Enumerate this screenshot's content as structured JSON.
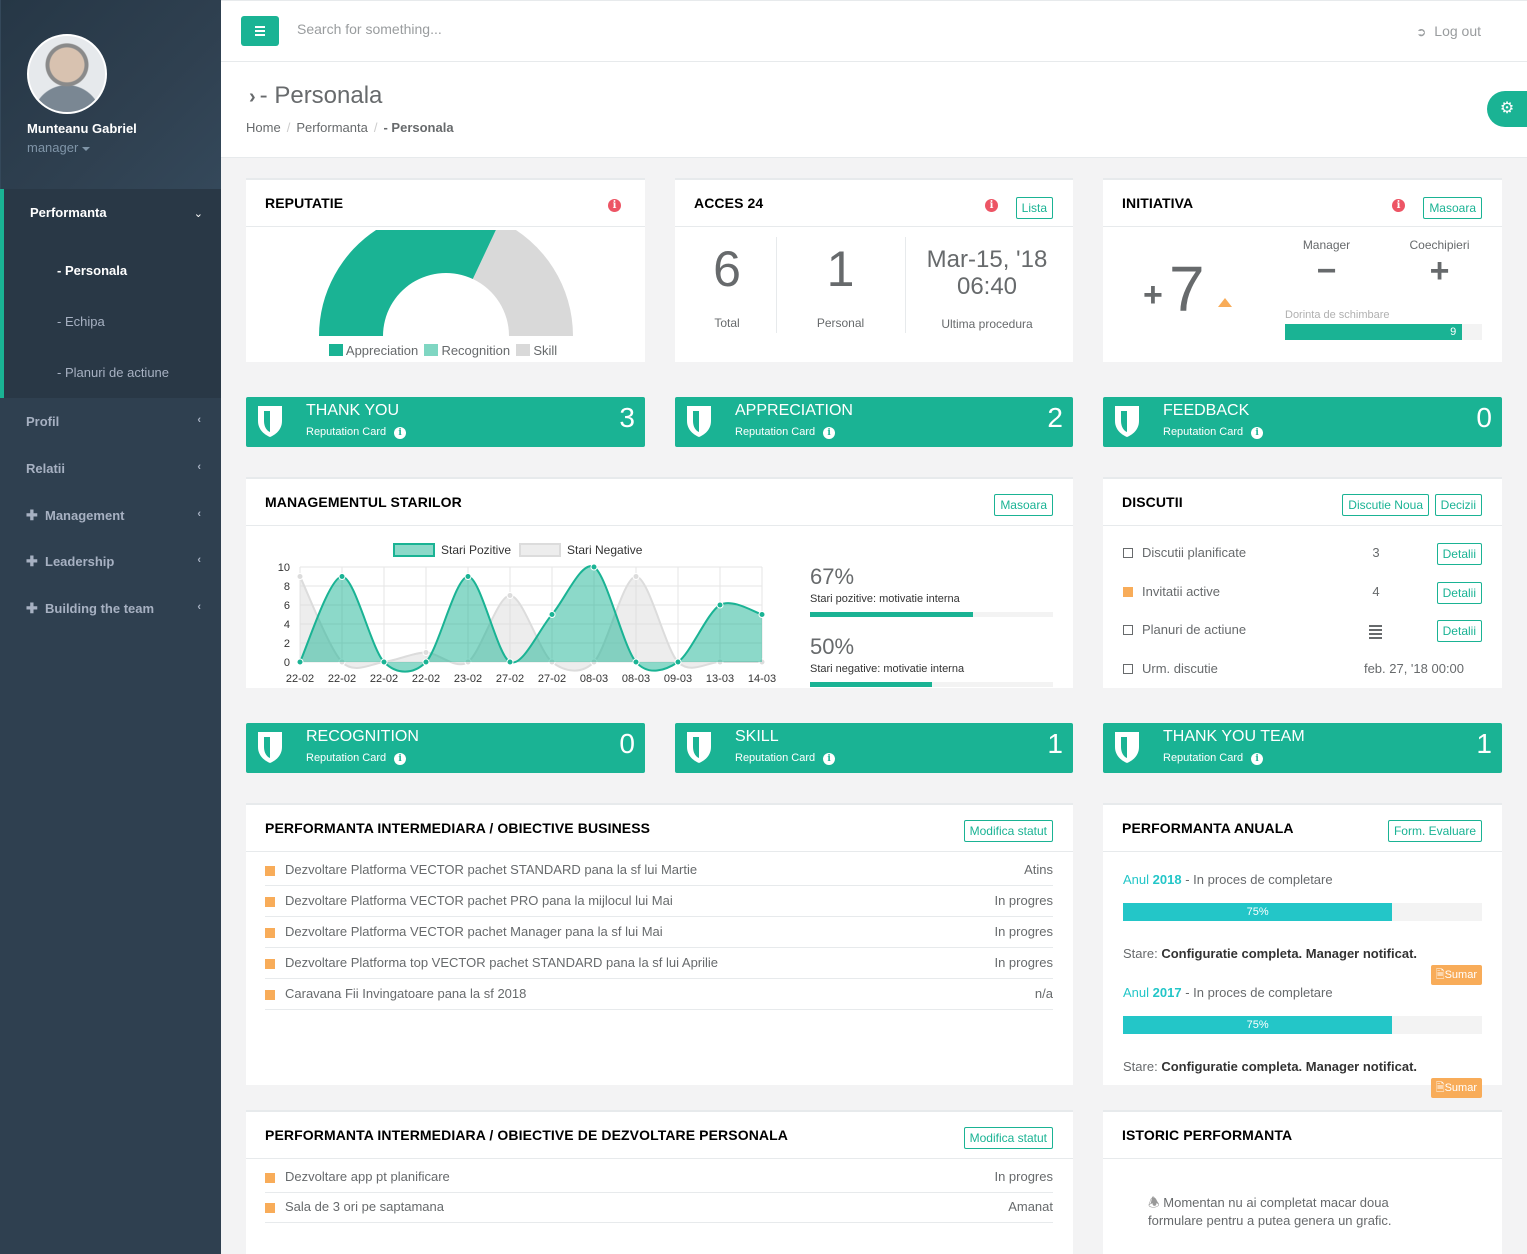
{
  "sidebar": {
    "user_name": "Munteanu Gabriel",
    "user_role": "manager",
    "active_section": "Performanta",
    "sub_items": [
      "- Personala",
      "- Echipa",
      "- Planuri de actiune"
    ],
    "items": [
      "Profil",
      "Relatii"
    ],
    "plus_items": [
      "Management",
      "Leadership",
      "Building the team"
    ]
  },
  "topbar": {
    "search_placeholder": "Search for something...",
    "logout_label": "Log out"
  },
  "header": {
    "title": "- Personala",
    "breadcrumb": [
      "Home",
      "Performanta",
      "- Personala"
    ]
  },
  "reputatie": {
    "title": "REPUTATIE",
    "legend": [
      "Appreciation",
      "Recognition",
      "Skill"
    ],
    "appreciation_fraction": 0.64,
    "colors": {
      "appreciation": "#1ab394",
      "recognition": "#7fd6c2",
      "skill": "#d9d9d9"
    }
  },
  "acces": {
    "title": "ACCES 24",
    "button": "Lista",
    "total_value": "6",
    "total_label": "Total",
    "personal_value": "1",
    "personal_label": "Personal",
    "date_line1": "Mar-15, '18",
    "date_line2": "06:40",
    "date_label": "Ultima procedura"
  },
  "initiativa": {
    "title": "INITIATIVA",
    "button": "Masoara",
    "big_plus": "+",
    "big_value": "7",
    "manager_label": "Manager",
    "manager_value": "−",
    "coech_label": "Coechipieri",
    "coech_value": "+",
    "dorinta_label": "Dorinta de schimbare",
    "dorinta_value": "9",
    "dorinta_fraction": 0.9
  },
  "rep_cards_top": [
    {
      "title": "THANK YOU",
      "sub": "Reputation Card",
      "value": "3"
    },
    {
      "title": "APPRECIATION",
      "sub": "Reputation Card",
      "value": "2"
    },
    {
      "title": "FEEDBACK",
      "sub": "Reputation Card",
      "value": "0"
    }
  ],
  "rep_cards_bottom": [
    {
      "title": "RECOGNITION",
      "sub": "Reputation Card",
      "value": "0"
    },
    {
      "title": "SKILL",
      "sub": "Reputation Card",
      "value": "1"
    },
    {
      "title": "THANK YOU TEAM",
      "sub": "Reputation Card",
      "value": "1"
    }
  ],
  "stari": {
    "title": "MANAGEMENTUL STARILOR",
    "button": "Masoara",
    "pos_pct": "67%",
    "pos_label": "Stari pozitive: motivatie interna",
    "pos_fraction": 0.67,
    "neg_pct": "50%",
    "neg_label": "Stari negative: motivatie interna",
    "neg_fraction": 0.5
  },
  "chart_data": {
    "type": "area",
    "categories": [
      "22-02",
      "22-02",
      "22-02",
      "22-02",
      "23-02",
      "27-02",
      "27-02",
      "08-03",
      "08-03",
      "09-03",
      "13-03",
      "14-03"
    ],
    "series": [
      {
        "name": "Stari Pozitive",
        "values": [
          0,
          9,
          0,
          0,
          9,
          0,
          5,
          10,
          0,
          0,
          6,
          5
        ],
        "color": "#1ab394"
      },
      {
        "name": "Stari Negative",
        "values": [
          9,
          0,
          0,
          1,
          0,
          7,
          0,
          0,
          9,
          0,
          0,
          0
        ],
        "color": "#dcdcdc"
      }
    ],
    "yticks": [
      "0",
      "2",
      "4",
      "6",
      "8",
      "10"
    ],
    "ylim": [
      0,
      10
    ]
  },
  "discutii": {
    "title": "DISCUTII",
    "btn_new": "Discutie Noua",
    "btn_dec": "Decizii",
    "rows": [
      {
        "label": "Discutii planificate",
        "value": "3",
        "action": "Detalii"
      },
      {
        "label": "Invitatii active",
        "value": "4",
        "action": "Detalii"
      },
      {
        "label": "Planuri de actiune",
        "value": "",
        "action": "Detalii"
      },
      {
        "label": "Urm. discutie",
        "value": "feb. 27, '18 00:00",
        "action": ""
      }
    ]
  },
  "obiective_business": {
    "title": "PERFORMANTA INTERMEDIARA / OBIECTIVE BUSINESS",
    "button": "Modifica statut",
    "rows": [
      {
        "label": "Dezvoltare Platforma VECTOR pachet STANDARD pana la sf lui Martie",
        "status": "Atins"
      },
      {
        "label": "Dezvoltare Platforma VECTOR pachet PRO pana la mijlocul lui Mai",
        "status": "In progres"
      },
      {
        "label": "Dezvoltare Platforma VECTOR pachet Manager pana la sf lui Mai",
        "status": "In progres"
      },
      {
        "label": "Dezvoltare Platforma top VECTOR pachet STANDARD pana la sf lui Aprilie",
        "status": "In progres"
      },
      {
        "label": "Caravana Fii Invingatoare pana la sf 2018",
        "status": "n/a"
      }
    ]
  },
  "anuala": {
    "title": "PERFORMANTA ANUALA",
    "button": "Form. Evaluare",
    "years": [
      {
        "anul": "Anul",
        "year": "2018",
        "state": " - In proces de completare",
        "pct": "75%",
        "fraction": 0.75,
        "stare_label": "Stare:",
        "stare_value": "Configuratie completa. Manager notificat.",
        "sumar": "Sumar"
      },
      {
        "anul": "Anul",
        "year": "2017",
        "state": " - In proces de completare",
        "pct": "75%",
        "fraction": 0.75,
        "stare_label": "Stare:",
        "stare_value": "Configuratie completa. Manager notificat.",
        "sumar": "Sumar"
      }
    ]
  },
  "obiective_personal": {
    "title": "PERFORMANTA INTERMEDIARA / OBIECTIVE DE DEZVOLTARE PERSONALA",
    "button": "Modifica statut",
    "rows": [
      {
        "label": "Dezvoltare app pt planificare",
        "status": "In progres"
      },
      {
        "label": "Sala de 3 ori pe saptamana",
        "status": "Amanat"
      }
    ]
  },
  "istoric": {
    "title": "ISTORIC PERFORMANTA",
    "message_line1": "Momentan nu ai completat macar doua",
    "message_line2": "formulare pentru a putea genera un grafic."
  }
}
